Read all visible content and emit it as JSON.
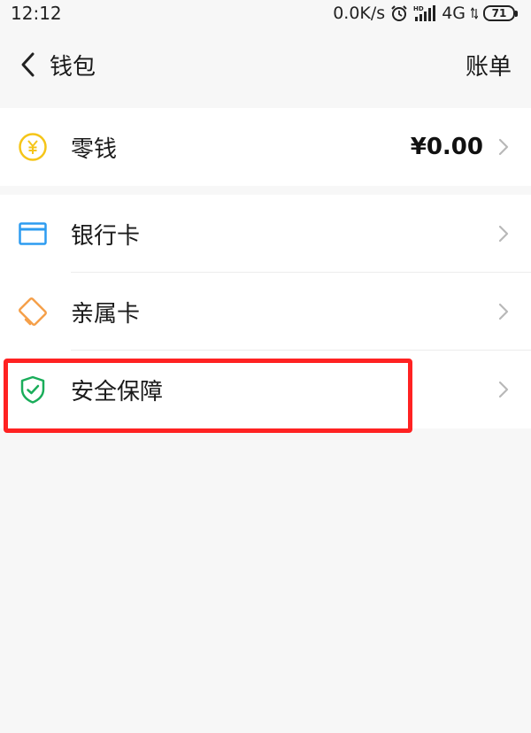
{
  "status_bar": {
    "time": "12:12",
    "network_speed": "0.0K/s",
    "alarm_icon": "alarm-icon",
    "signal_label": "HD",
    "network_type": "4G",
    "battery": "71"
  },
  "nav": {
    "back_icon": "chevron-left-icon",
    "title": "钱包",
    "action": "账单"
  },
  "balance_group": {
    "item": {
      "icon": "yuan-coin-icon",
      "label": "零钱",
      "value": "¥0.00"
    }
  },
  "card_group": {
    "items": [
      {
        "icon": "bank-card-icon",
        "label": "银行卡"
      },
      {
        "icon": "family-card-icon",
        "label": "亲属卡"
      },
      {
        "icon": "shield-check-icon",
        "label": "安全保障"
      }
    ]
  },
  "colors": {
    "background": "#f7f7f7",
    "row_background": "#ffffff",
    "coin": "#f5c518",
    "bank_card": "#2d9cf0",
    "family_card": "#f5a04a",
    "shield": "#1aad5a",
    "highlight": "#ff2222"
  }
}
